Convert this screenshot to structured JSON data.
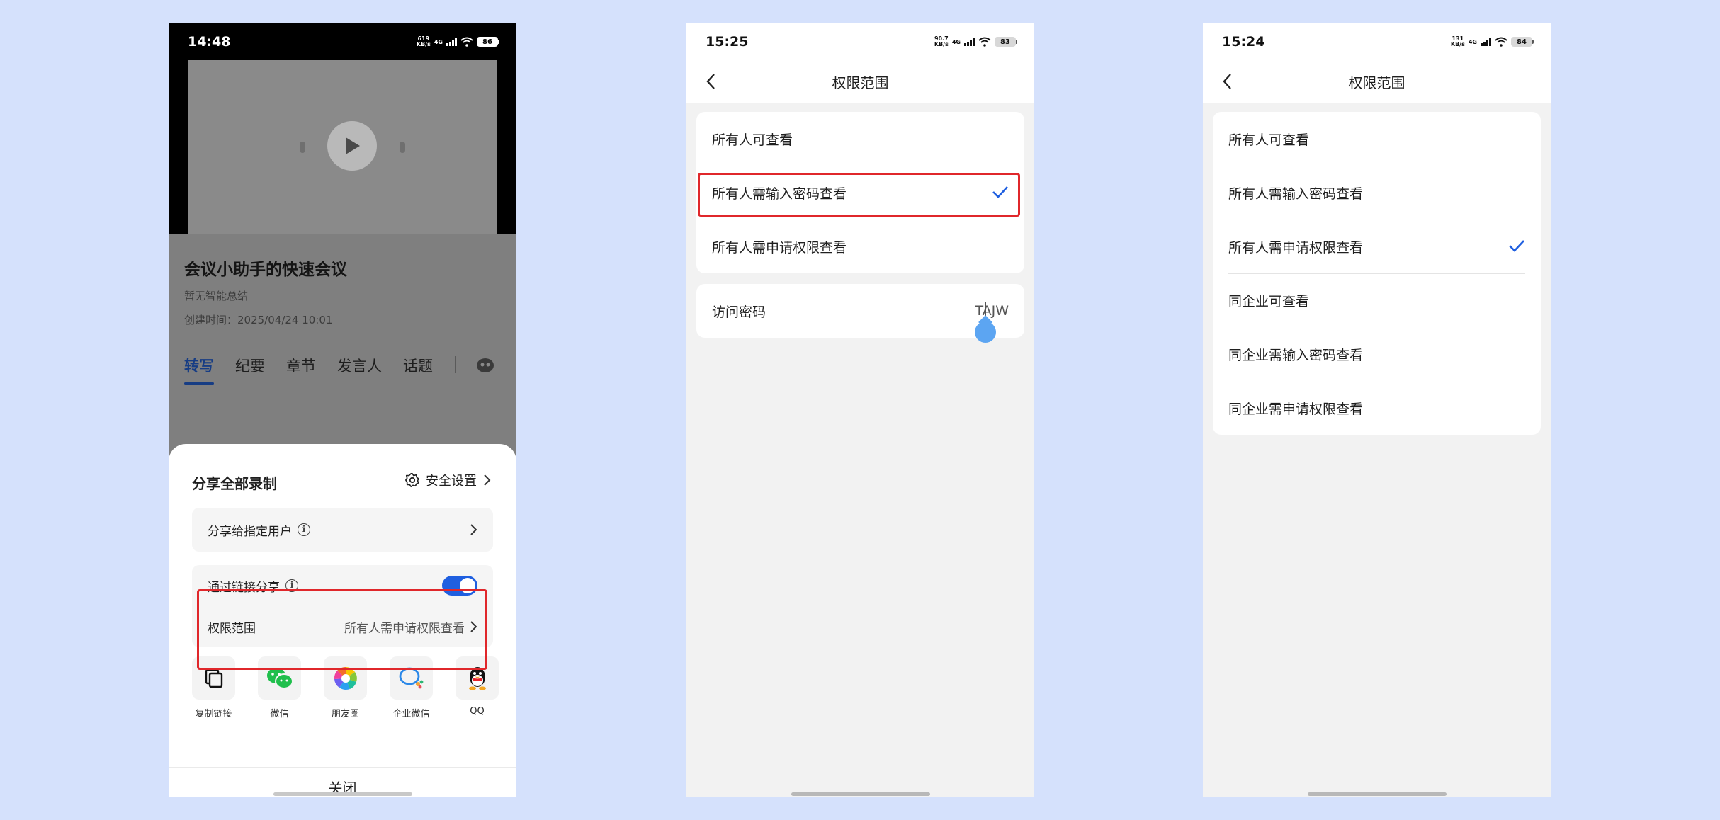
{
  "colors": {
    "accent": "#1f5fe0",
    "highlight": "#e0272b",
    "background": "#d5e1fc"
  },
  "phone1": {
    "status": {
      "time": "14:48",
      "speed_value": "619",
      "speed_unit": "KB/s",
      "network": "4G",
      "battery": "86"
    },
    "meeting": {
      "title": "会议小助手的快速会议",
      "summary": "暂无智能总结",
      "created": "创建时间：2025/04/24 10:01"
    },
    "tabs": [
      "转写",
      "纪要",
      "章节",
      "发言人",
      "话题"
    ],
    "sheet": {
      "title": "分享全部录制",
      "security_label": "安全设置",
      "share_user_label": "分享给指定用户",
      "link_share_label": "通过链接分享",
      "link_share_enabled": true,
      "scope_label": "权限范围",
      "scope_value": "所有人需申请权限查看",
      "share_targets": [
        {
          "label": "复制链接",
          "icon": "copy-icon"
        },
        {
          "label": "微信",
          "icon": "wechat-icon"
        },
        {
          "label": "朋友圈",
          "icon": "moments-icon"
        },
        {
          "label": "企业微信",
          "icon": "wecom-icon"
        },
        {
          "label": "QQ",
          "icon": "qq-icon"
        }
      ],
      "close_label": "关闭"
    }
  },
  "phone2": {
    "status": {
      "time": "15:25",
      "speed_value": "90.7",
      "speed_unit": "KB/s",
      "network": "4G",
      "battery": "83"
    },
    "title": "权限范围",
    "options": [
      {
        "label": "所有人可查看",
        "selected": false
      },
      {
        "label": "所有人需输入密码查看",
        "selected": true
      },
      {
        "label": "所有人需申请权限查看",
        "selected": false
      }
    ],
    "password_label": "访问密码",
    "password_value": "TAJW"
  },
  "phone3": {
    "status": {
      "time": "15:24",
      "speed_value": "131",
      "speed_unit": "KB/s",
      "network": "4G",
      "battery": "84"
    },
    "title": "权限范围",
    "options": [
      {
        "label": "所有人可查看",
        "selected": false
      },
      {
        "label": "所有人需输入密码查看",
        "selected": false
      },
      {
        "label": "所有人需申请权限查看",
        "selected": true
      },
      {
        "label": "同企业可查看",
        "selected": false
      },
      {
        "label": "同企业需输入密码查看",
        "selected": false
      },
      {
        "label": "同企业需申请权限查看",
        "selected": false
      }
    ]
  }
}
